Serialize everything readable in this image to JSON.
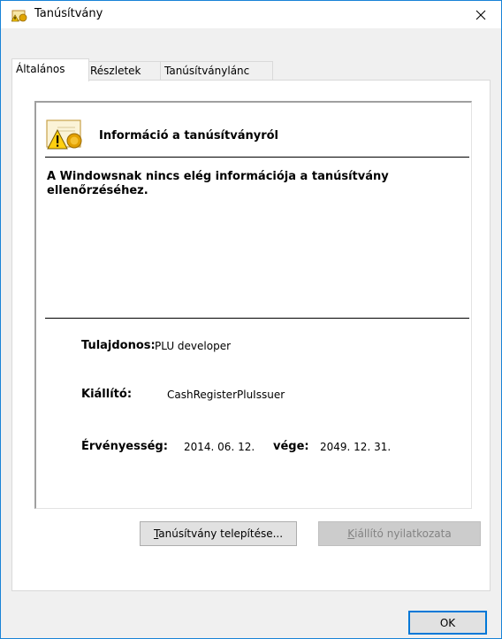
{
  "window": {
    "title": "Tanúsítvány"
  },
  "tabs": [
    {
      "label": "Általános",
      "active": true
    },
    {
      "label": "Részletek",
      "active": false
    },
    {
      "label": "Tanúsítványlánc",
      "active": false
    }
  ],
  "cert": {
    "heading": "Információ a tanúsítványról",
    "message": "A Windowsnak nincs elég információja a tanúsítvány ellenőrzéséhez.",
    "owner_label": "Tulajdonos:",
    "owner_value": "PLU developer",
    "issuer_label": "Kiállító:",
    "issuer_value": "CashRegisterPluIssuer",
    "validity_label": "Érvényesség:",
    "valid_from": "2014. 06. 12.",
    "valid_to_label": "vége:",
    "valid_to": "2049. 12. 31."
  },
  "buttons": {
    "install_mnemonic": "T",
    "install_rest": "anúsítvány telepítése...",
    "issuer_statement_mnemonic": "K",
    "issuer_statement_rest": "iállító nyilatkozata",
    "ok": "OK"
  },
  "icons": {
    "window": "certificate-icon",
    "close": "close-icon",
    "cert": "certificate-warning-icon"
  },
  "colors": {
    "accent": "#0078d7",
    "window_border": "#1883d7"
  }
}
